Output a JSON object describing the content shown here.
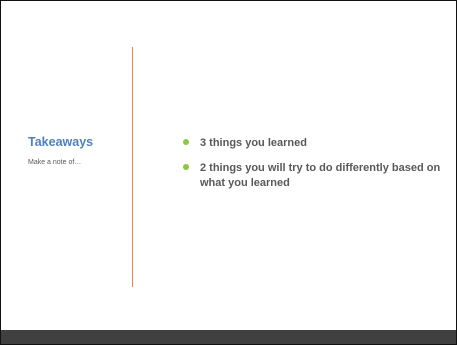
{
  "slide": {
    "title": "Takeaways",
    "subtitle": "Make a note of…",
    "bullets": [
      {
        "text": "3 things you learned"
      },
      {
        "text": "2 things you will try to do differently based on what you learned"
      }
    ]
  },
  "colors": {
    "title": "#4f81bd",
    "divider": "#e8884a",
    "bullet": "#8dc63f",
    "text": "#595959",
    "footer": "#404040"
  }
}
